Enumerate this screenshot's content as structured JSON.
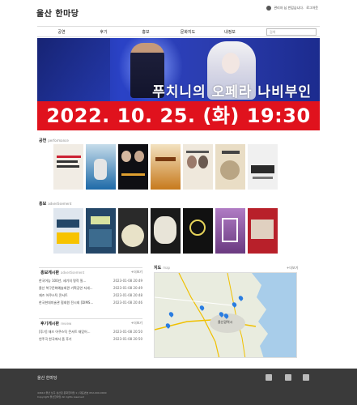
{
  "header": {
    "logo": "울산 한마당",
    "user_text": "관리자 님 반갑습니다.",
    "logout": "로그아웃"
  },
  "nav": {
    "items": [
      "공연",
      "후기",
      "홍보",
      "문화지도",
      "내정보"
    ],
    "search_placeholder": "검색"
  },
  "banner": {
    "title": "푸치니의 오페라 나비부인",
    "date": "2022. 10. 25. (화) 19:30"
  },
  "performance": {
    "title": "공연",
    "subtitle": "performance",
    "items": [
      {
        "label": "오페라 벽화",
        "color": "#f1ece4"
      },
      {
        "label": "",
        "color": "#1e6aa8"
      },
      {
        "label": "",
        "color": "#0f0f14"
      },
      {
        "label": "",
        "color": "#c77a1d"
      },
      {
        "label": "",
        "color": "#efe8dc"
      },
      {
        "label": "",
        "color": "#e9ddc5"
      },
      {
        "label": "",
        "color": "#f0f0f0"
      }
    ]
  },
  "promotion": {
    "title": "홍보",
    "subtitle": "advertisement",
    "items": [
      {
        "color": "#dfe6ee"
      },
      {
        "color": "#244768"
      },
      {
        "color": "#2a2a2a"
      },
      {
        "color": "#1a1a1a"
      },
      {
        "color": "#111111"
      },
      {
        "color": "#9e5fb0"
      },
      {
        "color": "#b8202a"
      }
    ]
  },
  "promo_board": {
    "title": "홍보게시판",
    "subtitle": "advertisement",
    "more": "+더보기",
    "rows": [
      {
        "text": "한국어능 100년, 세기의 명작 릴...",
        "date": "2023-01-08 20:49"
      },
      {
        "text": "울산 북구문화예술회관 기획공연 지세...",
        "date": "2023-01-08 20:49"
      },
      {
        "text": "재즈 어쿠스틱 콘서트",
        "date": "2023-01-08 20:48"
      },
      {
        "text": "한국현대미술관 협회원 전시회 [DIMS...",
        "date": "2023-01-08 20:46"
      }
    ]
  },
  "review_board": {
    "title": "후기게시판",
    "subtitle": "review",
    "more": "+더보기",
    "rows": [
      {
        "text": "[후기] 재즈 어쿠스틱 콘서트 재밌어...",
        "date": "2023-01-08 20:50"
      },
      {
        "text": "연주곡 한국에서 좀 후기",
        "date": "2023-01-08 20:50"
      }
    ]
  },
  "map_box": {
    "title": "지도",
    "subtitle": "map",
    "more": "+더보기",
    "city_label": "울산광역시"
  },
  "footer": {
    "logo": "울산 한마당",
    "line1": "44610 울산 남구 삼산로 문화한마당 1 | 대표번호 052-000-0000",
    "line2": "Copyright 울산한마당 All rights reserved"
  }
}
